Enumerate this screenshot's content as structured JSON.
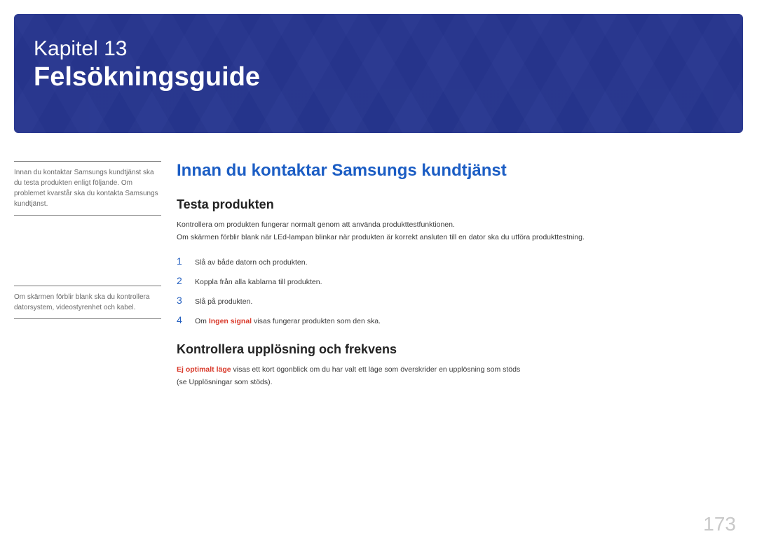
{
  "banner": {
    "chapter_label": "Kapitel 13",
    "chapter_title": "Felsökningsguide"
  },
  "sidebar": {
    "note1": "Innan du kontaktar Samsungs kundtjänst ska du testa produkten enligt följande. Om problemet kvarstår ska du kontakta Samsungs kundtjänst.",
    "note2": "Om skärmen förblir blank ska du kontrollera datorsystem, videostyrenhet och kabel."
  },
  "main": {
    "section_title": "Innan du kontaktar Samsungs kundtjänst",
    "sub1_title": "Testa produkten",
    "sub1_p1": "Kontrollera om produkten fungerar normalt genom att använda produkttestfunktionen.",
    "sub1_p2": "Om skärmen förblir blank när LEd-lampan blinkar när produkten är korrekt ansluten till en dator ska du utföra produkttestning.",
    "steps": [
      {
        "n": "1",
        "text": "Slå av både datorn och produkten."
      },
      {
        "n": "2",
        "text": "Koppla från alla kablarna till produkten."
      },
      {
        "n": "3",
        "text": "Slå på produkten."
      }
    ],
    "step4_n": "4",
    "step4_prefix": "Om ",
    "step4_bold": "Ingen signal",
    "step4_suffix": " visas fungerar produkten som den ska.",
    "sub2_title": "Kontrollera upplösning och frekvens",
    "sub2_bold": "Ej optimalt läge",
    "sub2_rest": " visas ett kort ögonblick om du har valt ett läge som överskrider en upplösning som stöds",
    "sub2_line2": "(se Upplösningar som stöds)."
  },
  "page_number": "173"
}
